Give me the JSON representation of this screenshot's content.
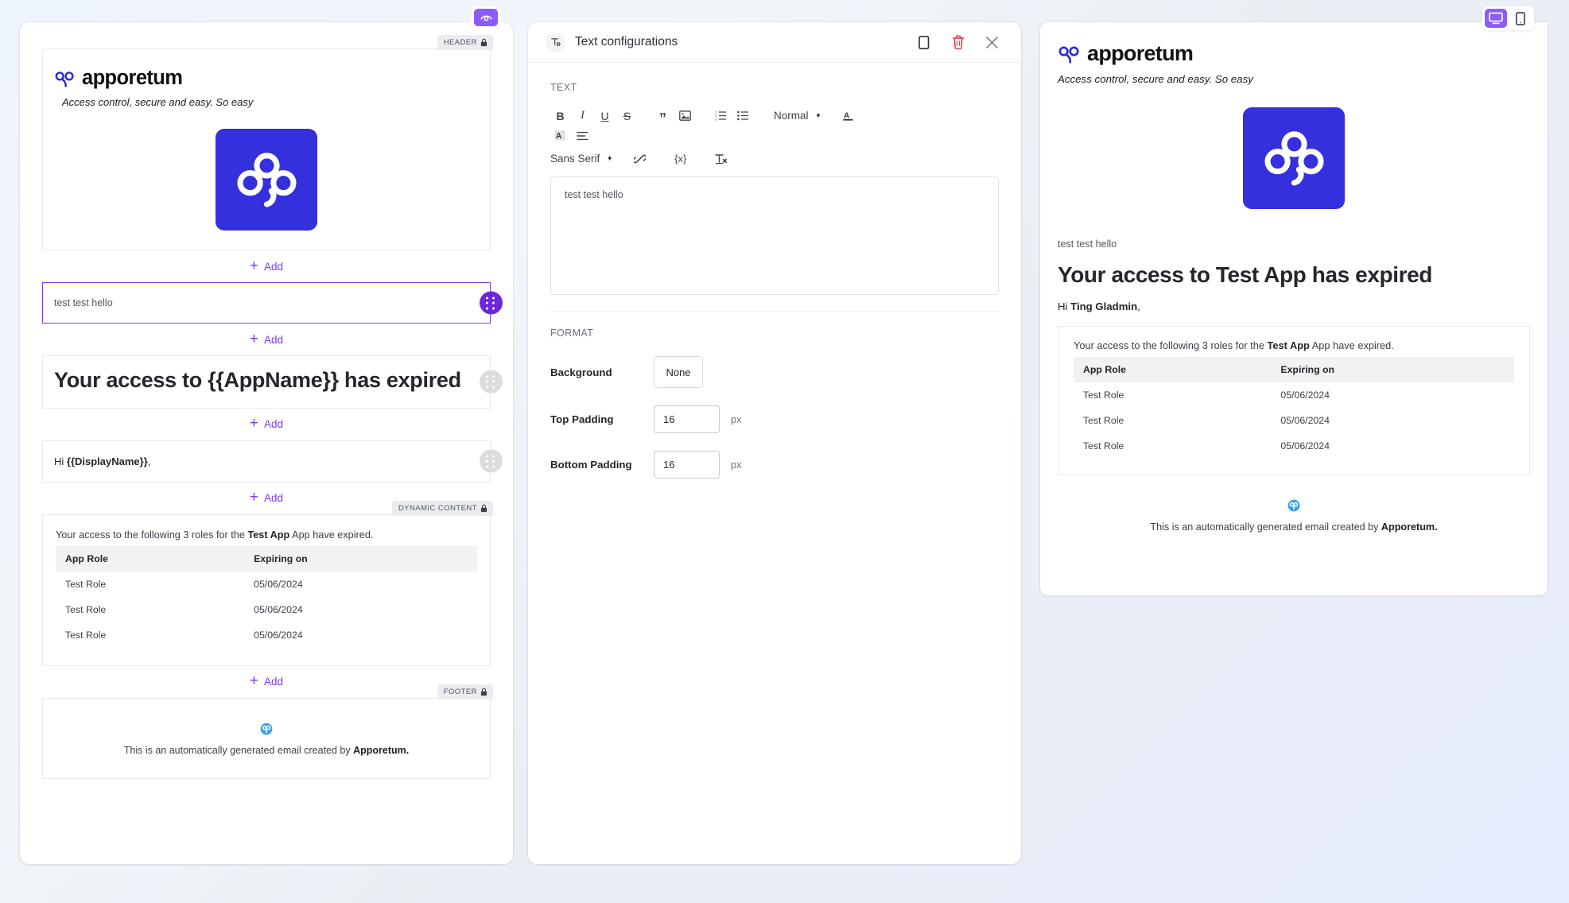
{
  "toolbar_top": {
    "preview_icon": "eye-icon",
    "device_desktop_icon": "desktop-icon",
    "device_mobile_icon": "mobile-icon"
  },
  "brand": {
    "name": "apporetum",
    "tagline": "Access control, secure and easy. So easy",
    "logo_icon": "apporetum-clover-logo"
  },
  "editor": {
    "badges": {
      "header": "HEADER",
      "dynamic_content": "DYNAMIC CONTENT",
      "footer": "FOOTER",
      "lock_icon": "lock-icon"
    },
    "add_label": "Add",
    "add_icon": "plus-icon",
    "drag_handle_icon": "drag-handle-icon",
    "blocks": {
      "text_value": "test test hello",
      "heading": "Your access to {{AppName}} has expired",
      "greeting_prefix": "Hi ",
      "greeting_token": "{{DisplayName}}",
      "greeting_suffix": ","
    },
    "dynamic": {
      "lead_before": "Your access to the following 3 roles for the ",
      "lead_bold": "Test App",
      "lead_after": " App have expired.",
      "columns": [
        "App Role",
        "Expiring on"
      ],
      "rows": [
        [
          "Test Role",
          "05/06/2024"
        ],
        [
          "Test Role",
          "05/06/2024"
        ],
        [
          "Test Role",
          "05/06/2024"
        ]
      ]
    },
    "footer": {
      "text_before": "This is an automatically generated email created by ",
      "text_bold": "Apporetum.",
      "icon": "apporetum-small-badge-icon"
    }
  },
  "config": {
    "title": "Text configurations",
    "title_icon": "text-block-icon",
    "actions": {
      "duplicate": "duplicate-icon",
      "delete": "trash-icon",
      "close": "close-icon"
    },
    "text_section_label": "TEXT",
    "format_section_label": "FORMAT",
    "rte": {
      "content": "test test hello",
      "block_format": "Normal",
      "font_family": "Sans Serif",
      "buttons": [
        {
          "name": "bold-icon",
          "glyph": "B"
        },
        {
          "name": "italic-icon",
          "glyph": "I"
        },
        {
          "name": "underline-icon",
          "glyph": "U"
        },
        {
          "name": "strikethrough-icon",
          "glyph": "S"
        },
        {
          "name": "blockquote-icon",
          "glyph": "”"
        },
        {
          "name": "image-icon",
          "glyph": "Ὓc"
        },
        {
          "name": "ordered-list-icon",
          "glyph": "1."
        },
        {
          "name": "bullet-list-icon",
          "glyph": "•"
        },
        {
          "name": "font-color-icon",
          "glyph": "A"
        },
        {
          "name": "highlight-color-icon",
          "glyph": "A"
        },
        {
          "name": "align-icon",
          "glyph": "≡"
        },
        {
          "name": "link-icon",
          "glyph": "🔗"
        },
        {
          "name": "merge-field-icon",
          "glyph": "{x}"
        },
        {
          "name": "clear-format-icon",
          "glyph": "Tx"
        }
      ]
    },
    "format": {
      "background_label": "Background",
      "background_value": "None",
      "top_padding_label": "Top Padding",
      "top_padding_value": "16",
      "bottom_padding_label": "Bottom Padding",
      "bottom_padding_value": "16",
      "unit": "px"
    }
  },
  "preview": {
    "text_block": "test test hello",
    "heading": "Your access to Test App has expired",
    "greeting_prefix": "Hi ",
    "greeting_name": "Ting Gladmin",
    "greeting_suffix": ",",
    "lead_before": "Your access to the following 3 roles for the ",
    "lead_bold": "Test App",
    "lead_after": " App have expired.",
    "columns": [
      "App Role",
      "Expiring on"
    ],
    "rows": [
      [
        "Test Role",
        "05/06/2024"
      ],
      [
        "Test Role",
        "05/06/2024"
      ],
      [
        "Test Role",
        "05/06/2024"
      ]
    ],
    "footer_before": "This is an automatically generated email created by ",
    "footer_bold": "Apporetum."
  },
  "colors": {
    "accent_purple": "#7c3aed",
    "handle_purple": "#6d28d9",
    "eye_purple": "#8b5cf6",
    "logo_blue": "#3430dd",
    "delete_red": "#e03131",
    "badge_gray": "#ececf0"
  }
}
